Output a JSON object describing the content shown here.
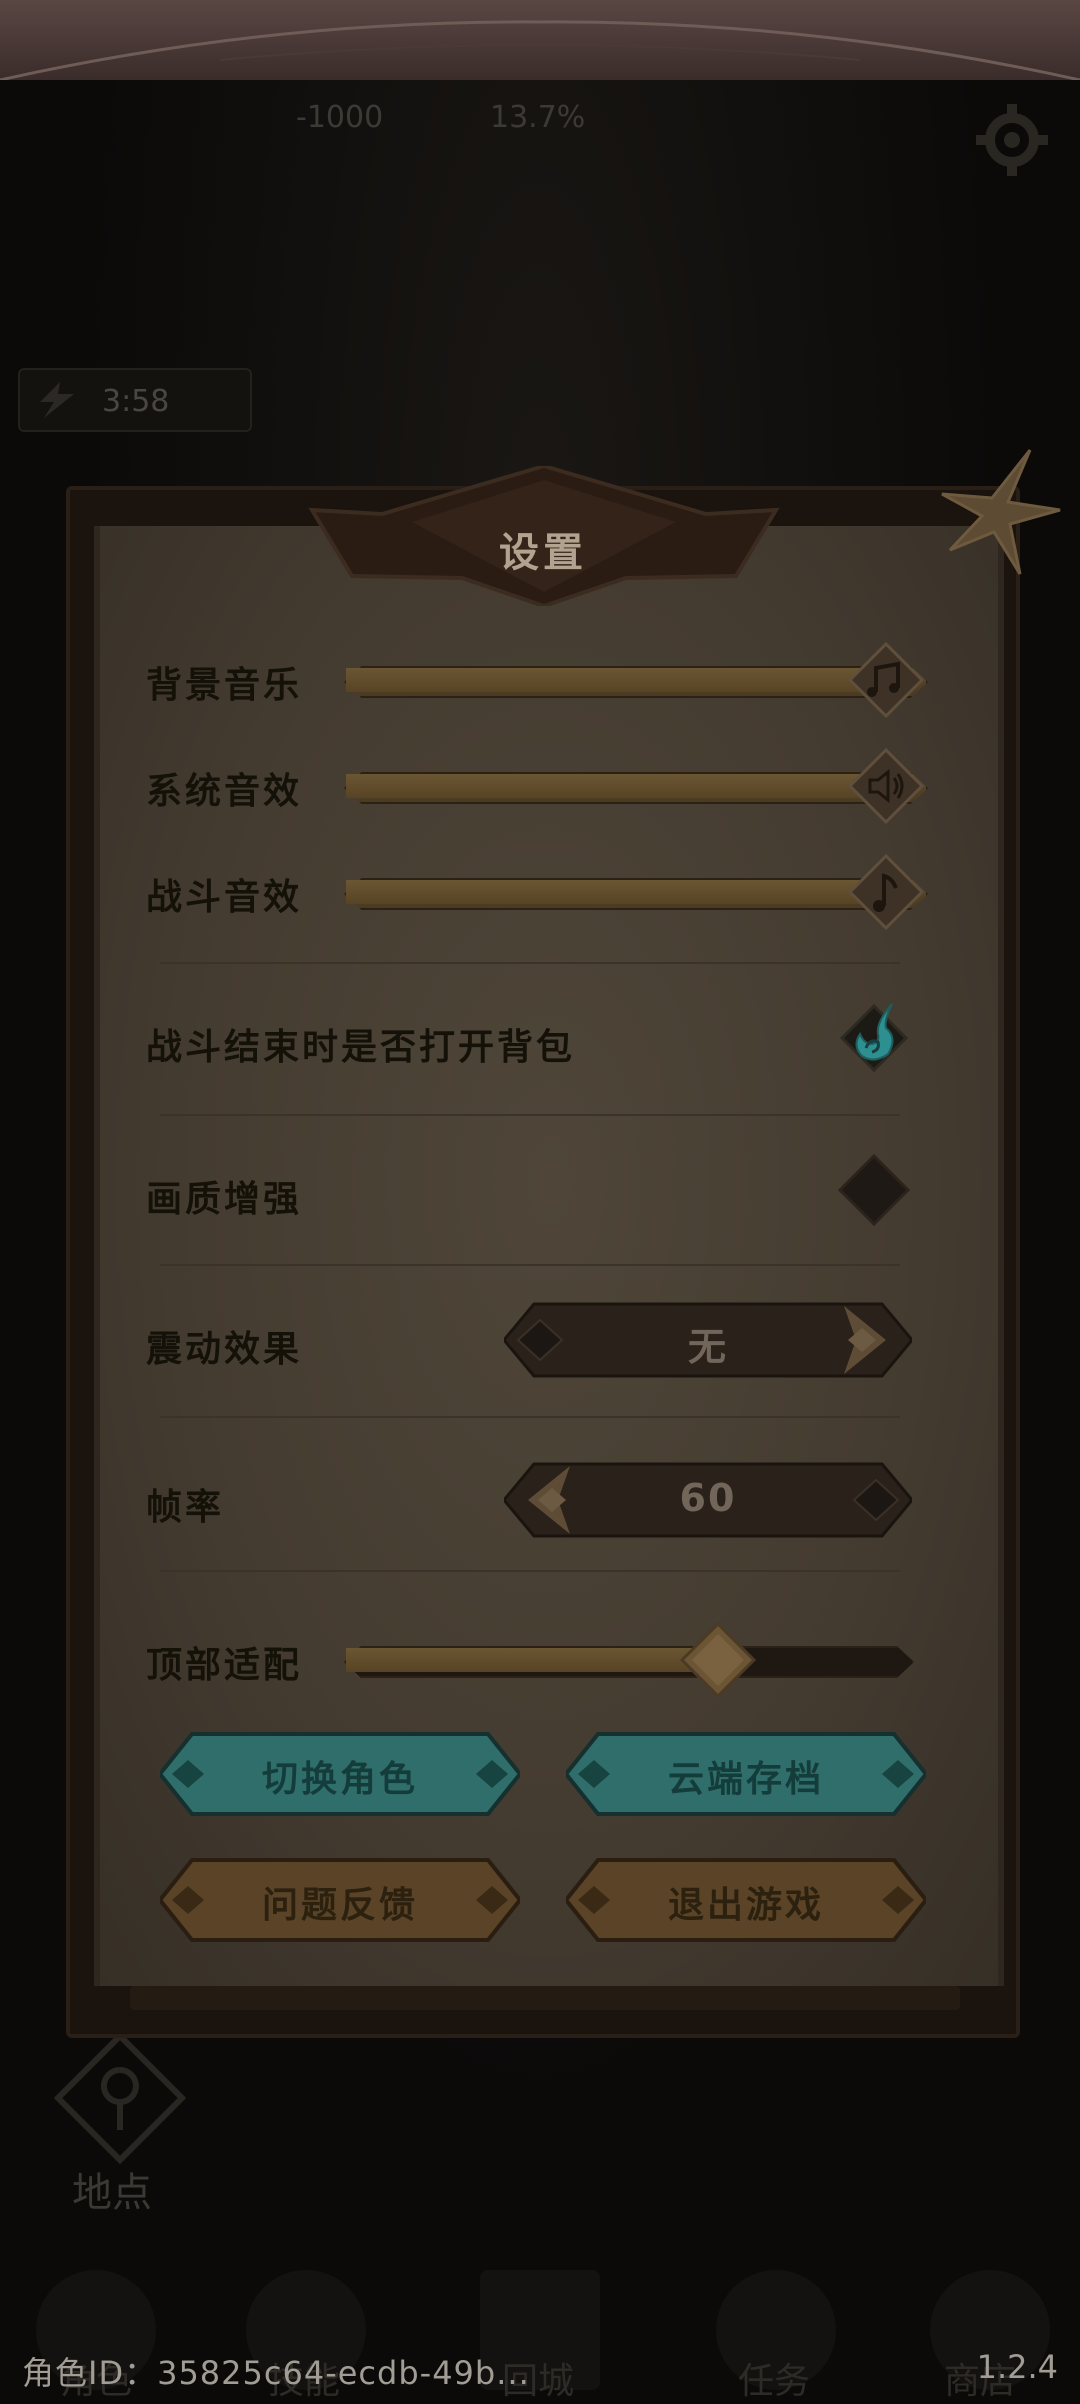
{
  "hud": {
    "top_value_left": "-1000",
    "top_value_right": "13.7%",
    "time": "3:58"
  },
  "bottom_nav": {
    "map_label": "地点",
    "items": [
      "角色",
      "技能",
      "回城",
      "任务",
      "商店"
    ]
  },
  "dialog": {
    "title": "设置",
    "sliders": [
      {
        "label": "背景音乐",
        "value": 1.0,
        "icon": "music-note-double-icon"
      },
      {
        "label": "系统音效",
        "value": 1.0,
        "icon": "speaker-icon"
      },
      {
        "label": "战斗音效",
        "value": 1.0,
        "icon": "music-note-icon"
      }
    ],
    "toggle_bag": {
      "label": "战斗结束时是否打开背包",
      "checked": true
    },
    "toggle_quality": {
      "label": "画质增强",
      "checked": false
    },
    "vibration": {
      "label": "震动效果",
      "value": "无"
    },
    "framerate": {
      "label": "帧率",
      "value": "60"
    },
    "top_adapt": {
      "label": "顶部适配",
      "value": 0.68
    },
    "buttons": {
      "switch_role": "切换角色",
      "cloud_save": "云端存档",
      "feedback": "问题反馈",
      "quit": "退出游戏"
    }
  },
  "footer": {
    "role_id": "角色ID：35825c64-ecdb-49b...",
    "version": "1.2.4"
  },
  "colors": {
    "panel": "#4a4034",
    "label": "#141109",
    "slider_fill": "#5d4a2a",
    "teal_button": "#2f6e6a",
    "brown_button": "#5a4326",
    "check_teal": "#2e8f90"
  }
}
